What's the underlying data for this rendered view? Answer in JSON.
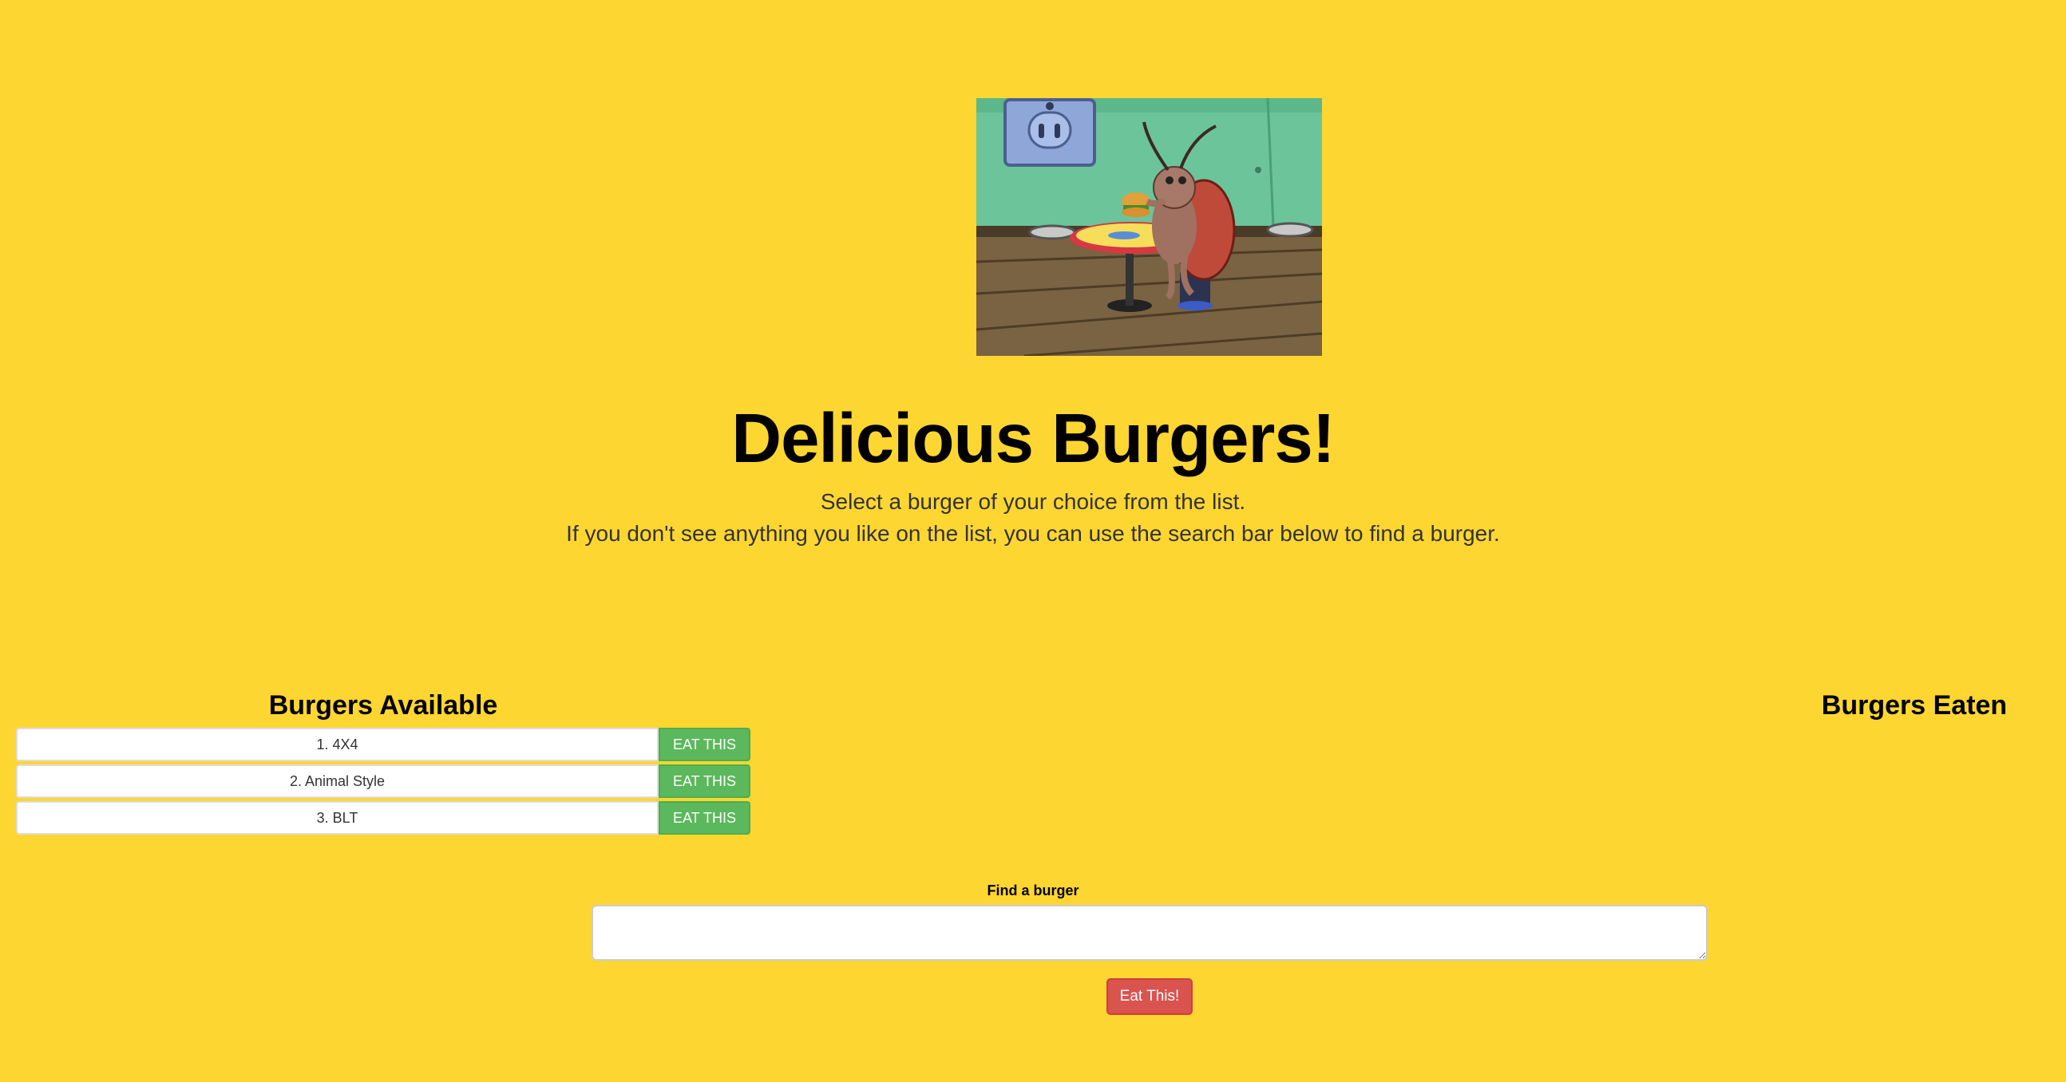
{
  "header": {
    "image_name": "cockroach-eating-burger-image",
    "title": "Delicious Burgers!",
    "subtitle_line1": "Select a burger of your choice from the list.",
    "subtitle_line2": "If you don't see anything you like on the list, you can use the search bar below to find a burger."
  },
  "available": {
    "title": "Burgers Available",
    "items": [
      {
        "label": "1. 4X4",
        "button": "EAT THIS"
      },
      {
        "label": "2. Animal Style",
        "button": "EAT THIS"
      },
      {
        "label": "3. BLT",
        "button": "EAT THIS"
      }
    ]
  },
  "eaten": {
    "title": "Burgers Eaten",
    "items": []
  },
  "search": {
    "label": "Find a burger",
    "value": "",
    "submit": "Eat This!"
  },
  "colors": {
    "background": "#FED631",
    "eat_button": "#5CB85C",
    "submit_button": "#D9534F"
  }
}
